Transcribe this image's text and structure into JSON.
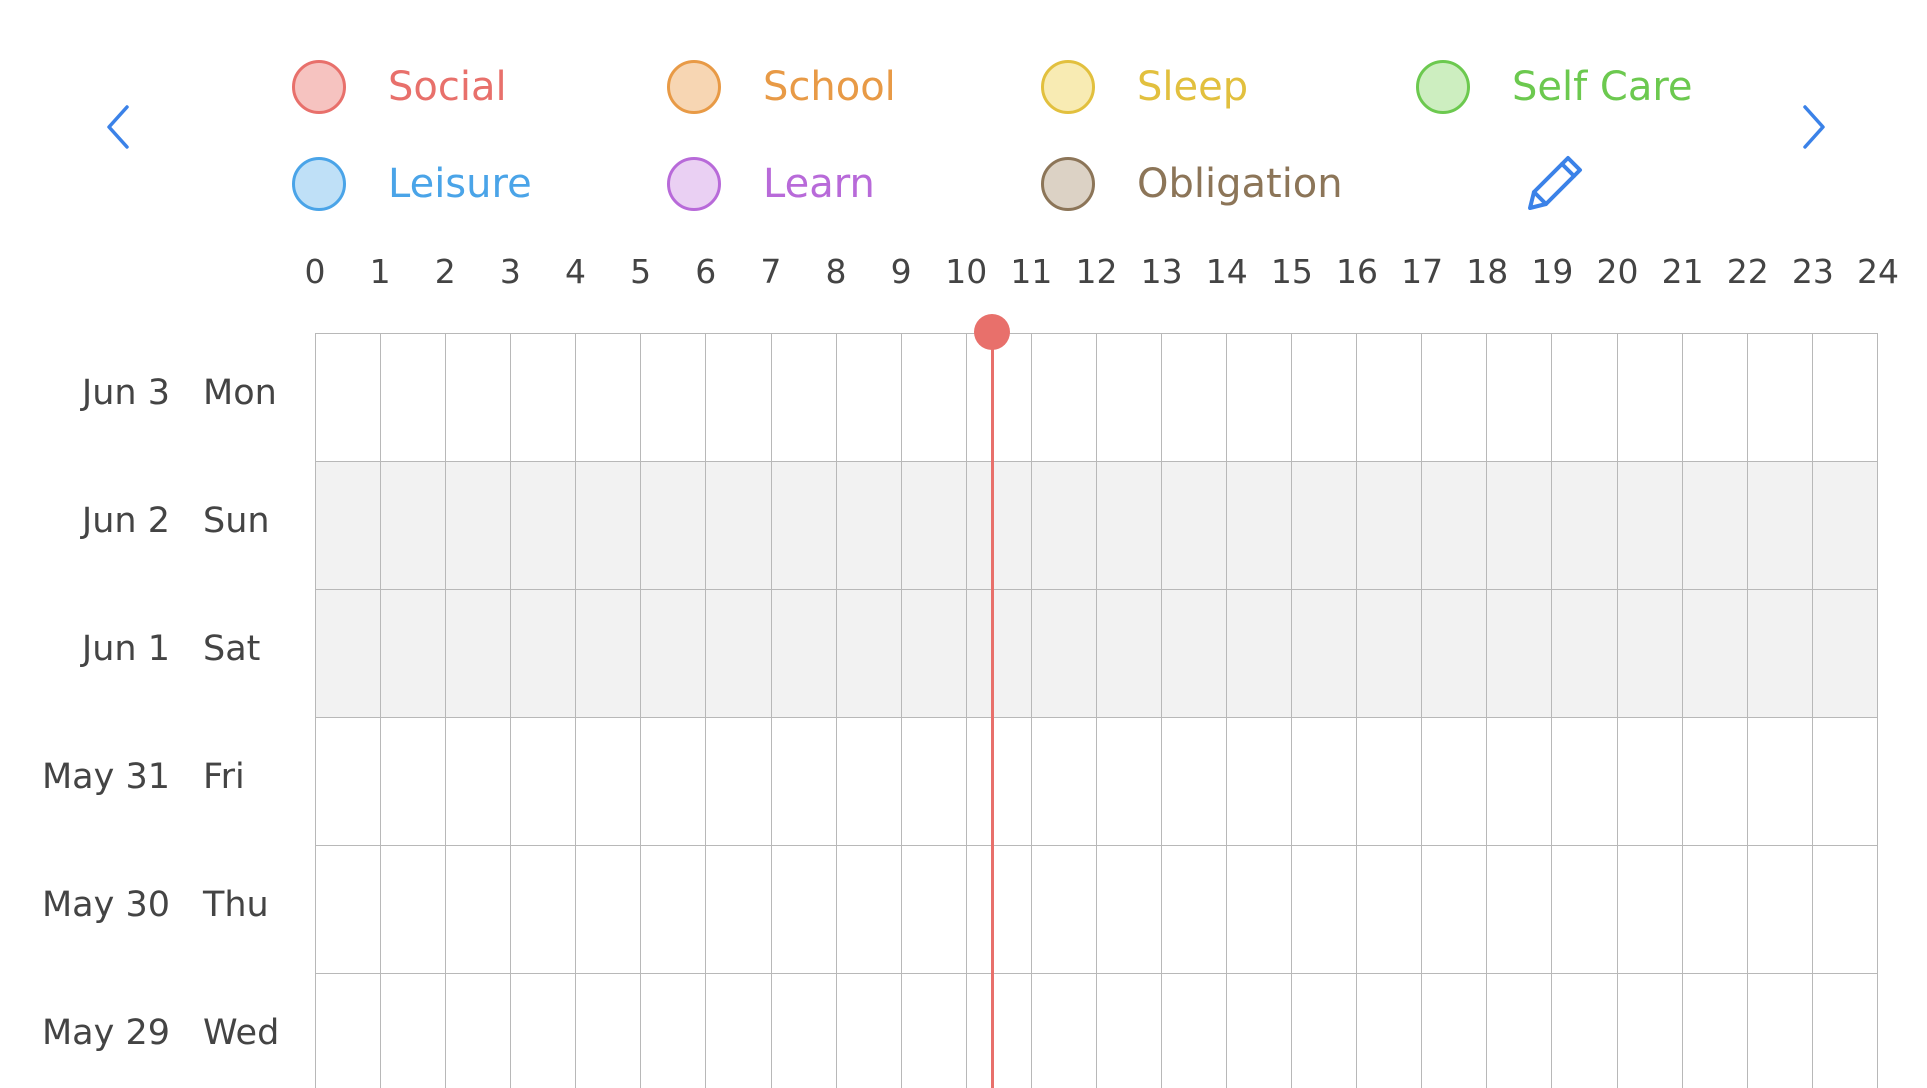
{
  "nav": {
    "prev": "previous-week",
    "next": "next-week"
  },
  "legend": [
    {
      "label": "Social",
      "color": "#e8706b",
      "fill": "#f6c3c0"
    },
    {
      "label": "School",
      "color": "#e89a46",
      "fill": "#f7d6b3"
    },
    {
      "label": "Sleep",
      "color": "#e2c03e",
      "fill": "#f8ebb3"
    },
    {
      "label": "Self Care",
      "color": "#6cc94f",
      "fill": "#cdeec0"
    },
    {
      "label": "Leisure",
      "color": "#4aa4e8",
      "fill": "#bfe0f7"
    },
    {
      "label": "Learn",
      "color": "#b86ad9",
      "fill": "#ead0f3"
    },
    {
      "label": "Obligation",
      "color": "#8c7558",
      "fill": "#dcd2c5"
    }
  ],
  "edit_icon": "pencil-icon",
  "hours": [
    "0",
    "1",
    "2",
    "3",
    "4",
    "5",
    "6",
    "7",
    "8",
    "9",
    "10",
    "11",
    "12",
    "13",
    "14",
    "15",
    "16",
    "17",
    "18",
    "19",
    "20",
    "21",
    "22",
    "23",
    "24"
  ],
  "days": [
    {
      "date": "Jun 3",
      "dow": "Mon",
      "weekend": false
    },
    {
      "date": "Jun 2",
      "dow": "Sun",
      "weekend": true
    },
    {
      "date": "Jun 1",
      "dow": "Sat",
      "weekend": true
    },
    {
      "date": "May 31",
      "dow": "Fri",
      "weekend": false
    },
    {
      "date": "May 30",
      "dow": "Thu",
      "weekend": false
    },
    {
      "date": "May 29",
      "dow": "Wed",
      "weekend": false
    }
  ],
  "current_time_hour": 10.4,
  "colors": {
    "accent": "#3b82e8",
    "now_indicator": "#e8706b",
    "grid": "#b8b8b8",
    "weekend_bg": "#f2f2f2"
  }
}
